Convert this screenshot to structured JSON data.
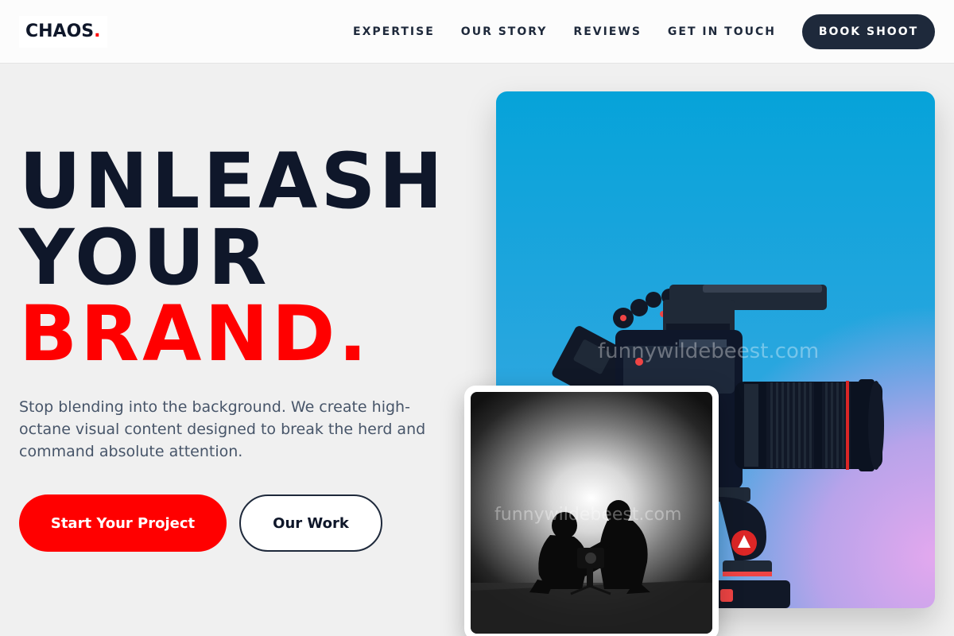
{
  "header": {
    "logo_text": "CHAOS",
    "logo_dot": ".",
    "nav": [
      {
        "label": "EXPERTISE"
      },
      {
        "label": "OUR STORY"
      },
      {
        "label": "REVIEWS"
      },
      {
        "label": "GET IN TOUCH"
      }
    ],
    "book_label": "BOOK SHOOT"
  },
  "hero": {
    "line1": "UNLEASH",
    "line2": "YOUR",
    "line3": "BRAND.",
    "subtext": "Stop blending into the background. We create high-octane visual content designed to break the herd and command absolute attention.",
    "primary_cta": "Start Your Project",
    "secondary_cta": "Our Work"
  },
  "images": {
    "main_watermark": "funnywildebeest.com",
    "photo_watermark": "funnywildebeest.com"
  },
  "colors": {
    "accent": "#ff0000",
    "dark": "#0f172a",
    "button_dark": "#1e293b"
  }
}
